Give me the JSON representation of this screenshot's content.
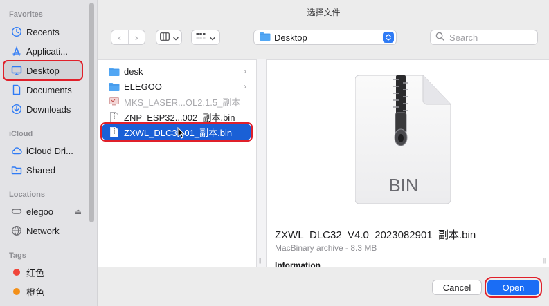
{
  "sidebar": {
    "favorites_title": "Favorites",
    "favorites": [
      {
        "label": "Recents",
        "icon": "clock-icon"
      },
      {
        "label": "Applicati...",
        "icon": "applications-icon"
      },
      {
        "label": "Desktop",
        "icon": "desktop-icon"
      },
      {
        "label": "Documents",
        "icon": "document-icon"
      },
      {
        "label": "Downloads",
        "icon": "downloads-icon"
      }
    ],
    "icloud_title": "iCloud",
    "icloud": [
      {
        "label": "iCloud Dri...",
        "icon": "cloud-icon"
      },
      {
        "label": "Shared",
        "icon": "shared-folder-icon"
      }
    ],
    "locations_title": "Locations",
    "locations": [
      {
        "label": "elegoo",
        "icon": "drive-icon",
        "eject": "⏏"
      },
      {
        "label": "Network",
        "icon": "globe-icon"
      }
    ],
    "tags_title": "Tags",
    "tags": [
      {
        "label": "红色",
        "color": "#f0453a"
      },
      {
        "label": "橙色",
        "color": "#f39019"
      }
    ]
  },
  "window": {
    "title": "选择文件"
  },
  "toolbar": {
    "back": "‹",
    "forward": "›",
    "location": "Desktop",
    "search_placeholder": "Search"
  },
  "files": [
    {
      "name": "desk",
      "type": "folder",
      "chevron": "›"
    },
    {
      "name": "ELEGOO",
      "type": "folder",
      "chevron": "›"
    },
    {
      "name": "MKS_LASER...OL2.1.5_副本",
      "type": "app-disabled"
    },
    {
      "name": "ZNP_ESP32...002_副本.bin",
      "type": "binary"
    },
    {
      "name": "ZXWL_DLC3...01_副本.bin",
      "type": "binary",
      "selected": true
    }
  ],
  "preview": {
    "icon_label": "BIN",
    "file_name": "ZXWL_DLC32_V4.0_2023082901_副本.bin",
    "kind": "MacBinary archive - 8.3 MB",
    "info_heading": "Information"
  },
  "buttons": {
    "cancel": "Cancel",
    "open": "Open"
  },
  "colors": {
    "accent": "#1a6df5",
    "highlight_outline": "#e0202a",
    "selection": "#1a60d6"
  }
}
